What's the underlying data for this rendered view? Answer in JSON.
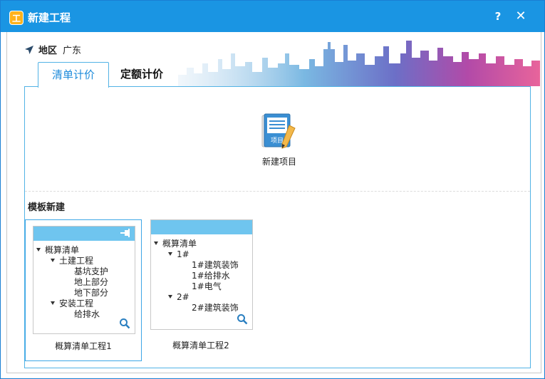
{
  "window": {
    "title": "新建工程",
    "help_label": "?",
    "close_label": "✕",
    "icon_label": "工"
  },
  "region": {
    "label": "地区",
    "value": "广东"
  },
  "tabs": [
    {
      "label": "清单计价",
      "active": true
    },
    {
      "label": "定额计价",
      "active": false
    }
  ],
  "new_project": {
    "label": "新建项目",
    "icon_text": "项目"
  },
  "templates": {
    "title": "模板新建",
    "cards": [
      {
        "label": "概算清单工程1",
        "selected": true,
        "tree": [
          {
            "text": "概算清单",
            "expanded": true,
            "level": 0
          },
          {
            "text": "土建工程",
            "expanded": true,
            "level": 1
          },
          {
            "text": "基坑支护",
            "level": 2
          },
          {
            "text": "地上部分",
            "level": 2
          },
          {
            "text": "地下部分",
            "level": 2
          },
          {
            "text": "安装工程",
            "expanded": true,
            "level": 1
          },
          {
            "text": "给排水",
            "level": 2
          }
        ]
      },
      {
        "label": "概算清单工程2",
        "selected": false,
        "tree": [
          {
            "text": "概算清单",
            "expanded": true,
            "level": 0
          },
          {
            "text": "1#",
            "expanded": true,
            "level": 1
          },
          {
            "text": "1#建筑装饰",
            "level": 2
          },
          {
            "text": "1#给排水",
            "level": 2
          },
          {
            "text": "1#电气",
            "level": 2
          },
          {
            "text": "2#",
            "expanded": true,
            "level": 1
          },
          {
            "text": "2#建筑装饰",
            "level": 2
          }
        ]
      }
    ]
  },
  "colors": {
    "titlebar": "#1a95e3",
    "accent": "#52b3e5",
    "card_header": "#6fc5ef",
    "icon_orange": "#ffb21c"
  }
}
